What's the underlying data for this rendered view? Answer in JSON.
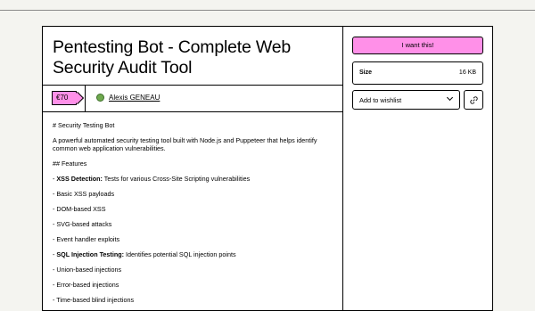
{
  "product": {
    "title": "Pentesting Bot - Complete Web Security Audit Tool",
    "price": "€70",
    "seller": "Alexis GENEAU"
  },
  "description": {
    "heading": "# Security Testing Bot",
    "intro": "A powerful automated security testing tool built with Node.js and Puppeteer that helps identify common web application vulnerabilities.",
    "features_heading": "## Features",
    "items": [
      {
        "prefix": "- ",
        "bold": "XSS Detection:",
        "text": " Tests for various Cross-Site Scripting vulnerabilities"
      },
      {
        "prefix": "- ",
        "bold": "",
        "text": "Basic XSS payloads"
      },
      {
        "prefix": "- ",
        "bold": "",
        "text": "DOM-based XSS"
      },
      {
        "prefix": "- ",
        "bold": "",
        "text": "SVG-based attacks"
      },
      {
        "prefix": "- ",
        "bold": "",
        "text": "Event handler exploits"
      },
      {
        "prefix": "- ",
        "bold": "SQL Injection Testing:",
        "text": " Identifies potential SQL injection points"
      },
      {
        "prefix": "- ",
        "bold": "",
        "text": "Union-based injections"
      },
      {
        "prefix": "- ",
        "bold": "",
        "text": "Error-based injections"
      },
      {
        "prefix": "- ",
        "bold": "",
        "text": "Time-based blind injections"
      }
    ]
  },
  "sidebar": {
    "want_label": "I want this!",
    "size_label": "Size",
    "size_value": "16 KB",
    "wishlist_label": "Add to wishlist"
  },
  "icons": {
    "wishlist_chevron": "chevron-down-icon",
    "share_link": "link-icon"
  },
  "colors": {
    "accent_pink": "#ff90e8",
    "avatar_green": "#6fa94f"
  }
}
